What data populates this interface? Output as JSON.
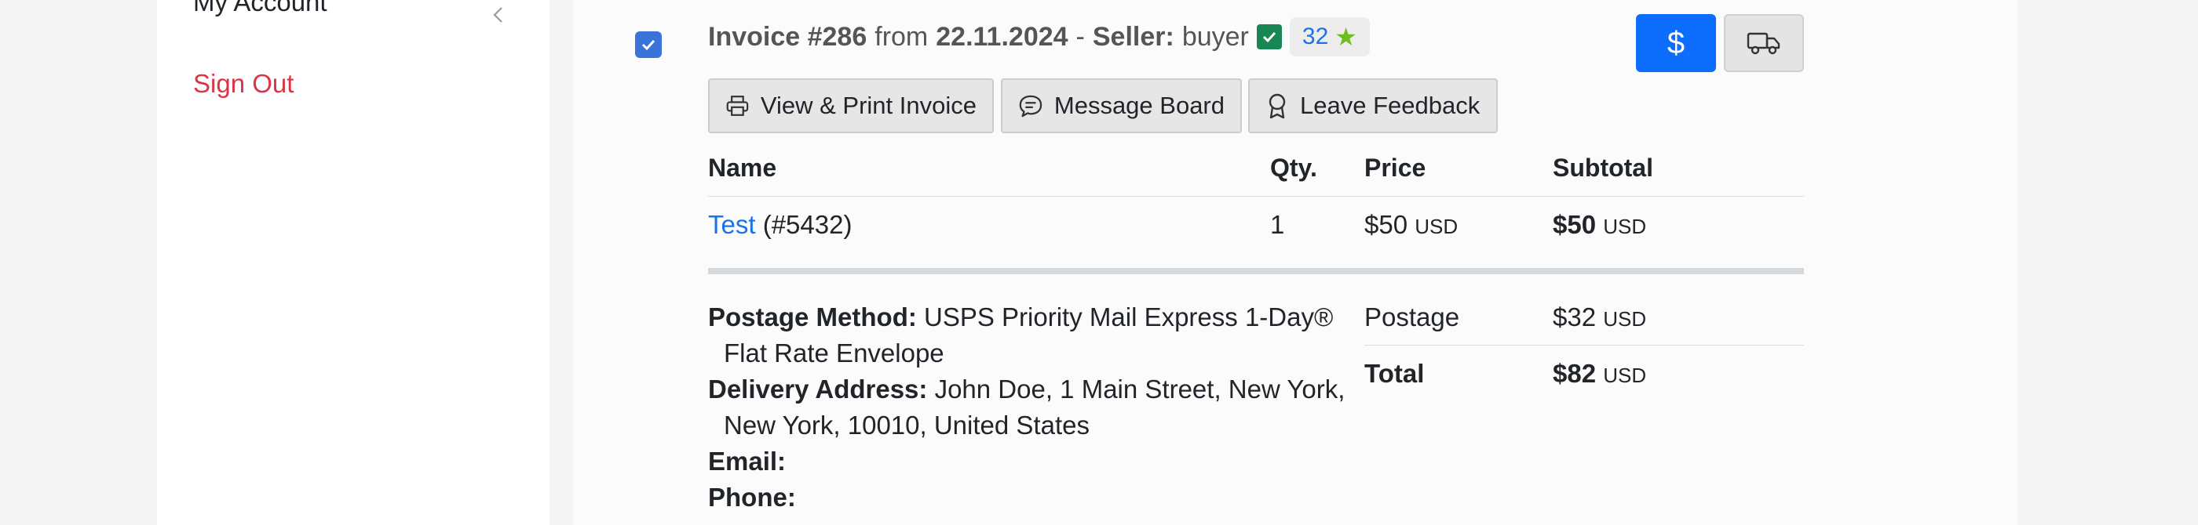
{
  "sidebar": {
    "my_account": "My Account",
    "sign_out": "Sign Out"
  },
  "invoice": {
    "title": "Invoice #286",
    "from_word": "from",
    "date": "22.11.2024",
    "dash": "-",
    "seller_label": "Seller:",
    "seller_name": "buyer",
    "rating": "32",
    "pay_icon": "$",
    "ship_icon": "truck-icon"
  },
  "actions": {
    "print": "View & Print Invoice",
    "message": "Message Board",
    "feedback": "Leave Feedback"
  },
  "table": {
    "headers": {
      "name": "Name",
      "qty": "Qty.",
      "price": "Price",
      "subtotal": "Subtotal"
    },
    "rows": [
      {
        "name_link": "Test",
        "item_id": "(#5432)",
        "qty": "1",
        "price": "$50",
        "price_cur": "USD",
        "subtotal": "$50",
        "subtotal_cur": "USD"
      }
    ]
  },
  "details": {
    "postage_method_label": "Postage Method:",
    "postage_method_line1": "USPS Priority Mail Express 1-Day®",
    "postage_method_line2": "Flat Rate Envelope",
    "delivery_label": "Delivery Address:",
    "delivery_line1": "John Doe, 1 Main Street, New York,",
    "delivery_line2": "New York, 10010, United States",
    "email_label": "Email:",
    "phone_label": "Phone:"
  },
  "totals": {
    "postage_label": "Postage",
    "postage_value": "$32",
    "postage_cur": "USD",
    "total_label": "Total",
    "total_value": "$82",
    "total_cur": "USD"
  },
  "colors": {
    "accent": "#0d6efd",
    "danger": "#dc3545",
    "success": "#198754",
    "link": "#1a73e8",
    "star": "#6cbf1e"
  }
}
